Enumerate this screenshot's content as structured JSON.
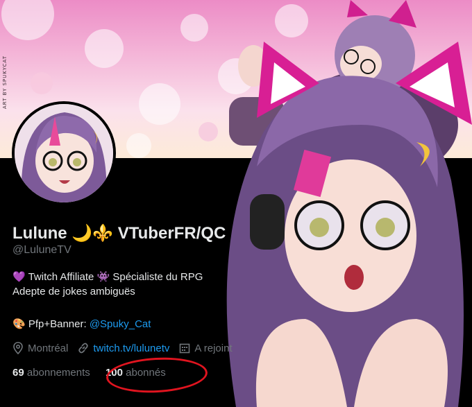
{
  "banner": {
    "credit": "ART BY SPUKYCAT"
  },
  "profile": {
    "display_name": "Lulune 🌙⚜️ VTuberFR/QC",
    "handle": "@LuluneTV",
    "bio_line1": "💜 Twitch Affiliate 👾 Spécialiste du RPG",
    "bio_line2": "Adepte de jokes ambiguës",
    "bio_line3_prefix": "🎨 Pfp+Banner: ",
    "bio_line3_mention": "@Spuky_Cat",
    "location": "Montréal",
    "website": "twitch.tv/lulunetv",
    "joined": "A rejoint",
    "following_count": "69",
    "following_label": "abonnements",
    "followers_count": "100",
    "followers_label": "abonnés"
  },
  "colors": {
    "background": "#000000",
    "text": "#e7e9ea",
    "muted": "#71767b",
    "link": "#1d9bf0",
    "highlight": "#e0141f"
  },
  "icons": [
    "location-icon",
    "link-icon",
    "calendar-icon"
  ]
}
